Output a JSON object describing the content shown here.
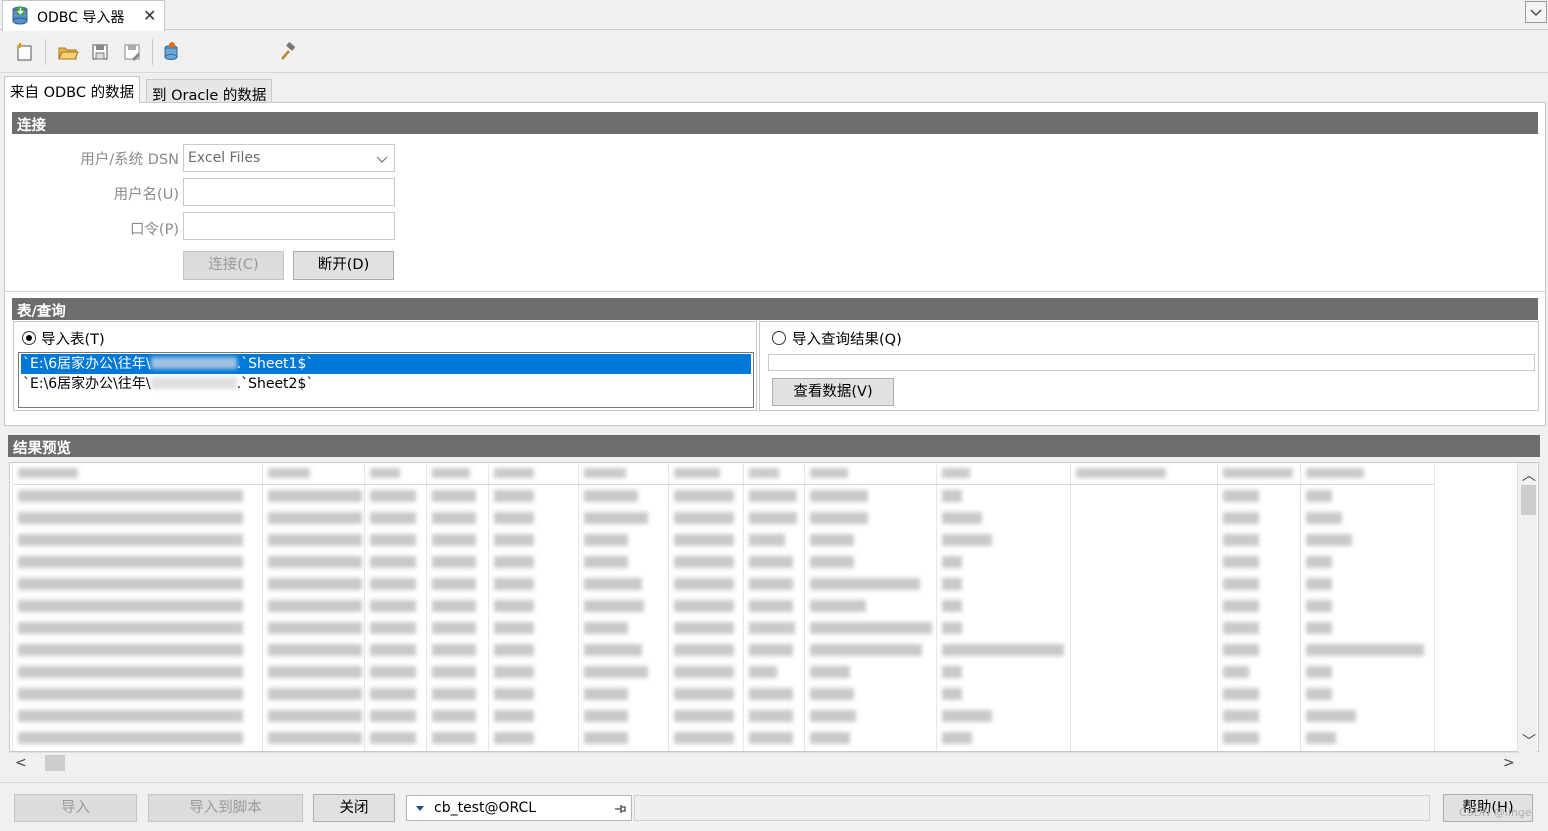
{
  "window": {
    "tab_title": "ODBC 导入器",
    "close_glyph": "✕",
    "menu_glyph": "﹀"
  },
  "toolbar": {
    "icons": [
      "new-icon",
      "open-folder-icon",
      "save-icon",
      "save-as-icon",
      "database-connect-icon",
      "hammer-icon"
    ]
  },
  "tabs": [
    {
      "label": "来自 ODBC 的数据",
      "active": true
    },
    {
      "label": "到 Oracle 的数据",
      "active": false
    }
  ],
  "connection": {
    "section_title": "连接",
    "dsn_label": "用户/系统 DSN",
    "dsn_value": "Excel Files",
    "username_label": "用户名(U)",
    "password_label": "口令(P)",
    "connect_button": "连接(C)",
    "disconnect_button": "断开(D)"
  },
  "table_query": {
    "section_title": "表/查询",
    "import_table_label": "导入表(T)",
    "import_table_selected": true,
    "tables": [
      {
        "prefix": "`E:\\6居家办公\\往年\\",
        "suffix": ".`Sheet1$`",
        "selected": true
      },
      {
        "prefix": "`E:\\6居家办公\\往年\\",
        "suffix": ".`Sheet2$`",
        "selected": false
      }
    ],
    "import_query_label": "导入查询结果(Q)",
    "query_text": "",
    "view_data_button": "查看数据(V)"
  },
  "preview": {
    "section_title": "结果预览",
    "row_count": 12,
    "scroll_up": "︿",
    "scroll_down": "﹀",
    "scroll_left": "<",
    "scroll_right": ">"
  },
  "bottom": {
    "import_button": "导入",
    "import_to_script_button": "导入到脚本",
    "close_button": "关闭",
    "connection_value": "cb_test@ORCL",
    "help_button": "帮助(H)"
  },
  "watermark": "CSDN @linge",
  "colors": {
    "section_header": "#6d6d6d",
    "selection": "#0078d7",
    "panel_bg": "#f0f0f0"
  }
}
